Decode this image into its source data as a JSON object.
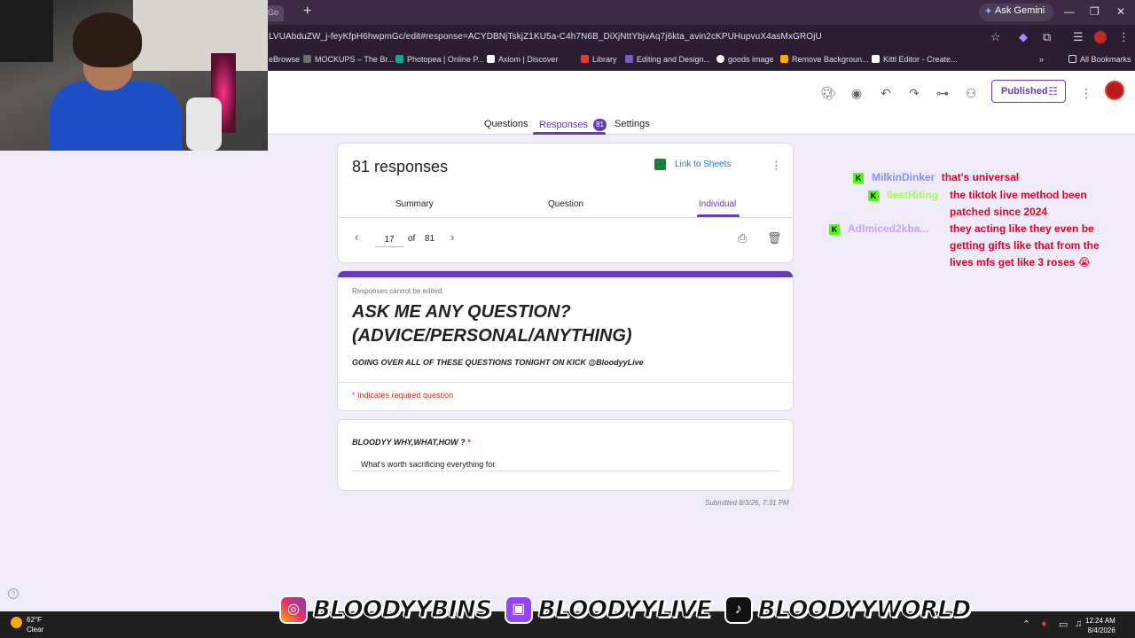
{
  "browser": {
    "tab_partial": "Go",
    "new_tab": "+",
    "gemini_label": "Ask Gemini",
    "url": "LVUAbduZW_j-feyKfpH6hwpmGc/edit#response=ACYDBNjTskjZ1KU5a-C4h7N6B_DiXjNttYbjvAq7j6kta_avin2cKPUHupvuX4asMxGROjU",
    "bookmarks": [
      {
        "label": "eBrowse",
        "color": "#2b1e33"
      },
      {
        "label": "MOCKUPS – The Br...",
        "color": "#6d6d6d"
      },
      {
        "label": "Photopea | Online P...",
        "color": "#18a497"
      },
      {
        "label": "Axiom | Discover",
        "color": "#ffffff"
      },
      {
        "label": "Library",
        "color": "#e53935"
      },
      {
        "label": "Editing and Design...",
        "color": "#7e57c2"
      },
      {
        "label": "goods image",
        "color": "#ffffff"
      },
      {
        "label": "Remove Backgroun...",
        "color": "#f9ab00"
      },
      {
        "label": "Kittl Editor - Create...",
        "color": "#ffffff"
      }
    ],
    "all_bookmarks": "All Bookmarks",
    "more_bookmarks": "»"
  },
  "header": {
    "published_label": "Published",
    "tabs": [
      {
        "label": "Questions"
      },
      {
        "label": "Responses",
        "badge": "81"
      },
      {
        "label": "Settings"
      }
    ]
  },
  "responses_card": {
    "title": "81 responses",
    "link_to_sheets": "Link to Sheets",
    "subtabs": [
      "Summary",
      "Question",
      "Individual"
    ],
    "current": "17",
    "of_label": "of",
    "total": "81"
  },
  "form": {
    "notice": "Responses cannot be edited",
    "title_line1": "ASK ME ANY QUESTION?",
    "title_line2": "(ADVICE/PERSONAL/ANYTHING)",
    "description": "GOING OVER ALL OF THESE QUESTIONS TONIGHT ON KICK @BloodyyLive",
    "required_note": "* Indicates required question"
  },
  "question": {
    "label": "BLOODYY WHY,WHAT,HOW ?",
    "required_mark": "*",
    "answer": "What's worth sacrificing everything for",
    "submitted": "Submitted 8/3/26, 7:31 PM"
  },
  "chat": [
    {
      "user": "MilkinDinker",
      "color": "#8b8bff",
      "lines": [
        "that's universal"
      ]
    },
    {
      "user": "IlestHiting",
      "color": "#9cff4d",
      "lines": [
        "the tiktok live method been",
        "patched since 2024"
      ]
    },
    {
      "user": "Adlmiced2kba...",
      "color": "#c9a0ff",
      "lines": [
        "they acting like they even be",
        "getting gifts like that from the",
        "lives mfs get like 3 roses 😭"
      ]
    }
  ],
  "banner": [
    {
      "icon": "instagram-icon",
      "glyph": "◎",
      "handle": "BLOODYYBINS"
    },
    {
      "icon": "twitch-icon",
      "glyph": "▣",
      "handle": "BLOODYYLIVE"
    },
    {
      "icon": "tiktok-icon",
      "glyph": "♪",
      "handle": "BLOODYYWORLD"
    }
  ],
  "taskbar": {
    "temp": "62°F",
    "condition": "Clear",
    "time": "12:24 AM",
    "date": "8/4/2026"
  },
  "colors": {
    "accent": "#673ab7",
    "page_bg": "#f0ebf8",
    "required": "#d93025",
    "sheets_link": "#1a73e8",
    "chat_message": "#e4002b",
    "kick_green": "#53fc18"
  }
}
